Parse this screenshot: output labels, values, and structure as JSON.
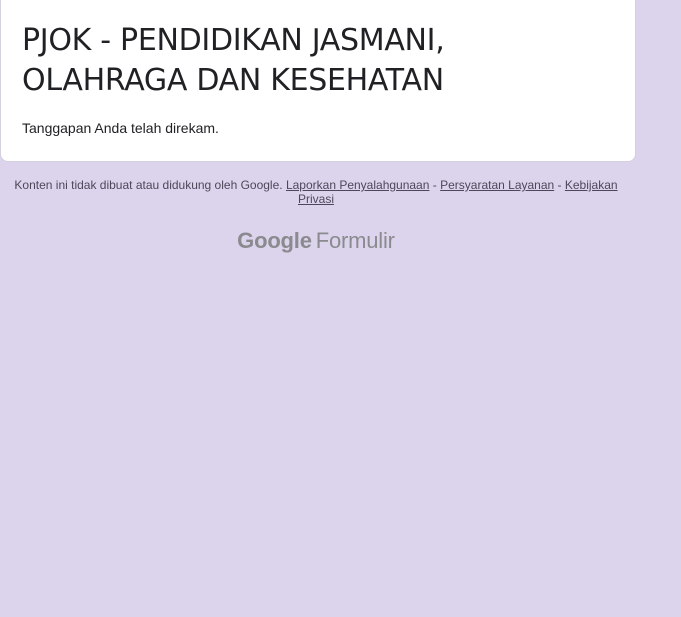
{
  "form": {
    "title": "PJOK - PENDIDIKAN JASMANI, OLAHRAGA DAN KESEHATAN",
    "confirmation": "Tanggapan Anda telah direkam."
  },
  "footer": {
    "disclaimer": "Konten ini tidak dibuat atau didukung oleh Google.",
    "separator": "-",
    "links": {
      "report_abuse": "Laporkan Penyalahgunaan",
      "terms": "Persyaratan Layanan",
      "privacy": "Kebijakan Privasi"
    }
  },
  "branding": {
    "company": "Google",
    "product": "Formulir"
  },
  "colors": {
    "background": "#dcd4ec",
    "card": "#ffffff",
    "text": "#202124",
    "footer_text": "#4d4859",
    "brand_gray": "#8a8a8f"
  }
}
